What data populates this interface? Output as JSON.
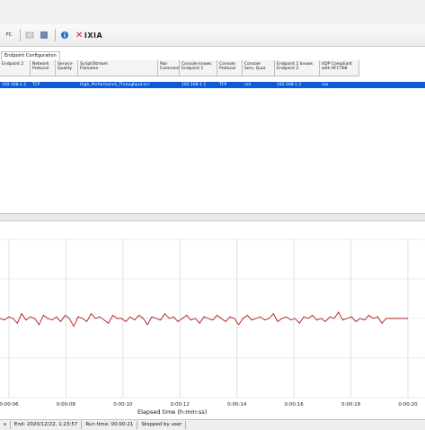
{
  "toolbar": {
    "items": [
      {
        "name": "fc-label",
        "text": "FC"
      },
      {
        "name": "run-icon"
      },
      {
        "name": "stop-icon"
      },
      {
        "name": "info-icon"
      }
    ],
    "logo_text": "IXIA"
  },
  "tabs": [
    {
      "label": "Endpoint Configuration"
    }
  ],
  "table": {
    "columns": [
      "Endpoint 2",
      "Network\nProtocol",
      "Service\nQuality",
      "Script/Stream\nFilename",
      "Pair\nComment",
      "Console knows\nEndpoint 1",
      "Console\nProtocol",
      "Console\nServ. Qual.",
      "Endpoint 1 knows\nEndpoint 2",
      "UDP Compliant\nwith RFC768"
    ],
    "rows": [
      [
        "192.168.1.2",
        "TCP",
        "",
        "High_Performance_Throughput.scr",
        "",
        "192.168.1.1",
        "TCP",
        "n/a",
        "192.168.1.2",
        "n/a"
      ]
    ]
  },
  "chart_data": {
    "type": "line",
    "xlabel": "Elapsed time (h:mm:ss)",
    "x_ticks": [
      "0:00:06",
      "0:00:08",
      "0:00:10",
      "0:00:12",
      "0:00:14",
      "0:00:16",
      "0:00:18",
      "0:00:20"
    ],
    "grid": true,
    "series": [
      {
        "color": "#b01818",
        "values": [
          0.5,
          0.49,
          0.51,
          0.5,
          0.47,
          0.53,
          0.49,
          0.51,
          0.5,
          0.46,
          0.52,
          0.5,
          0.49,
          0.51,
          0.48,
          0.52,
          0.5,
          0.45,
          0.51,
          0.5,
          0.48,
          0.53,
          0.5,
          0.51,
          0.49,
          0.47,
          0.52,
          0.5,
          0.5,
          0.48,
          0.51,
          0.49,
          0.52,
          0.5,
          0.46,
          0.51,
          0.5,
          0.49,
          0.53,
          0.5,
          0.51,
          0.48,
          0.5,
          0.52,
          0.49,
          0.5,
          0.47,
          0.51,
          0.5,
          0.49,
          0.52,
          0.5,
          0.48,
          0.51,
          0.5,
          0.46,
          0.5,
          0.52,
          0.49,
          0.5,
          0.51,
          0.49,
          0.5,
          0.53,
          0.48,
          0.5,
          0.51,
          0.49,
          0.5,
          0.47,
          0.51,
          0.5,
          0.52,
          0.49,
          0.5,
          0.48,
          0.51,
          0.5,
          0.54,
          0.49,
          0.5,
          0.51,
          0.48,
          0.5,
          0.49,
          0.52,
          0.5,
          0.51,
          0.47,
          0.5,
          0.5,
          0.5,
          0.5,
          0.5,
          0.5
        ]
      }
    ]
  },
  "status": {
    "start": "s",
    "end": "End: 2020/12/22, 1:23:57",
    "runtime": "Run time: 00:00:21",
    "state": "Stopped by user"
  }
}
